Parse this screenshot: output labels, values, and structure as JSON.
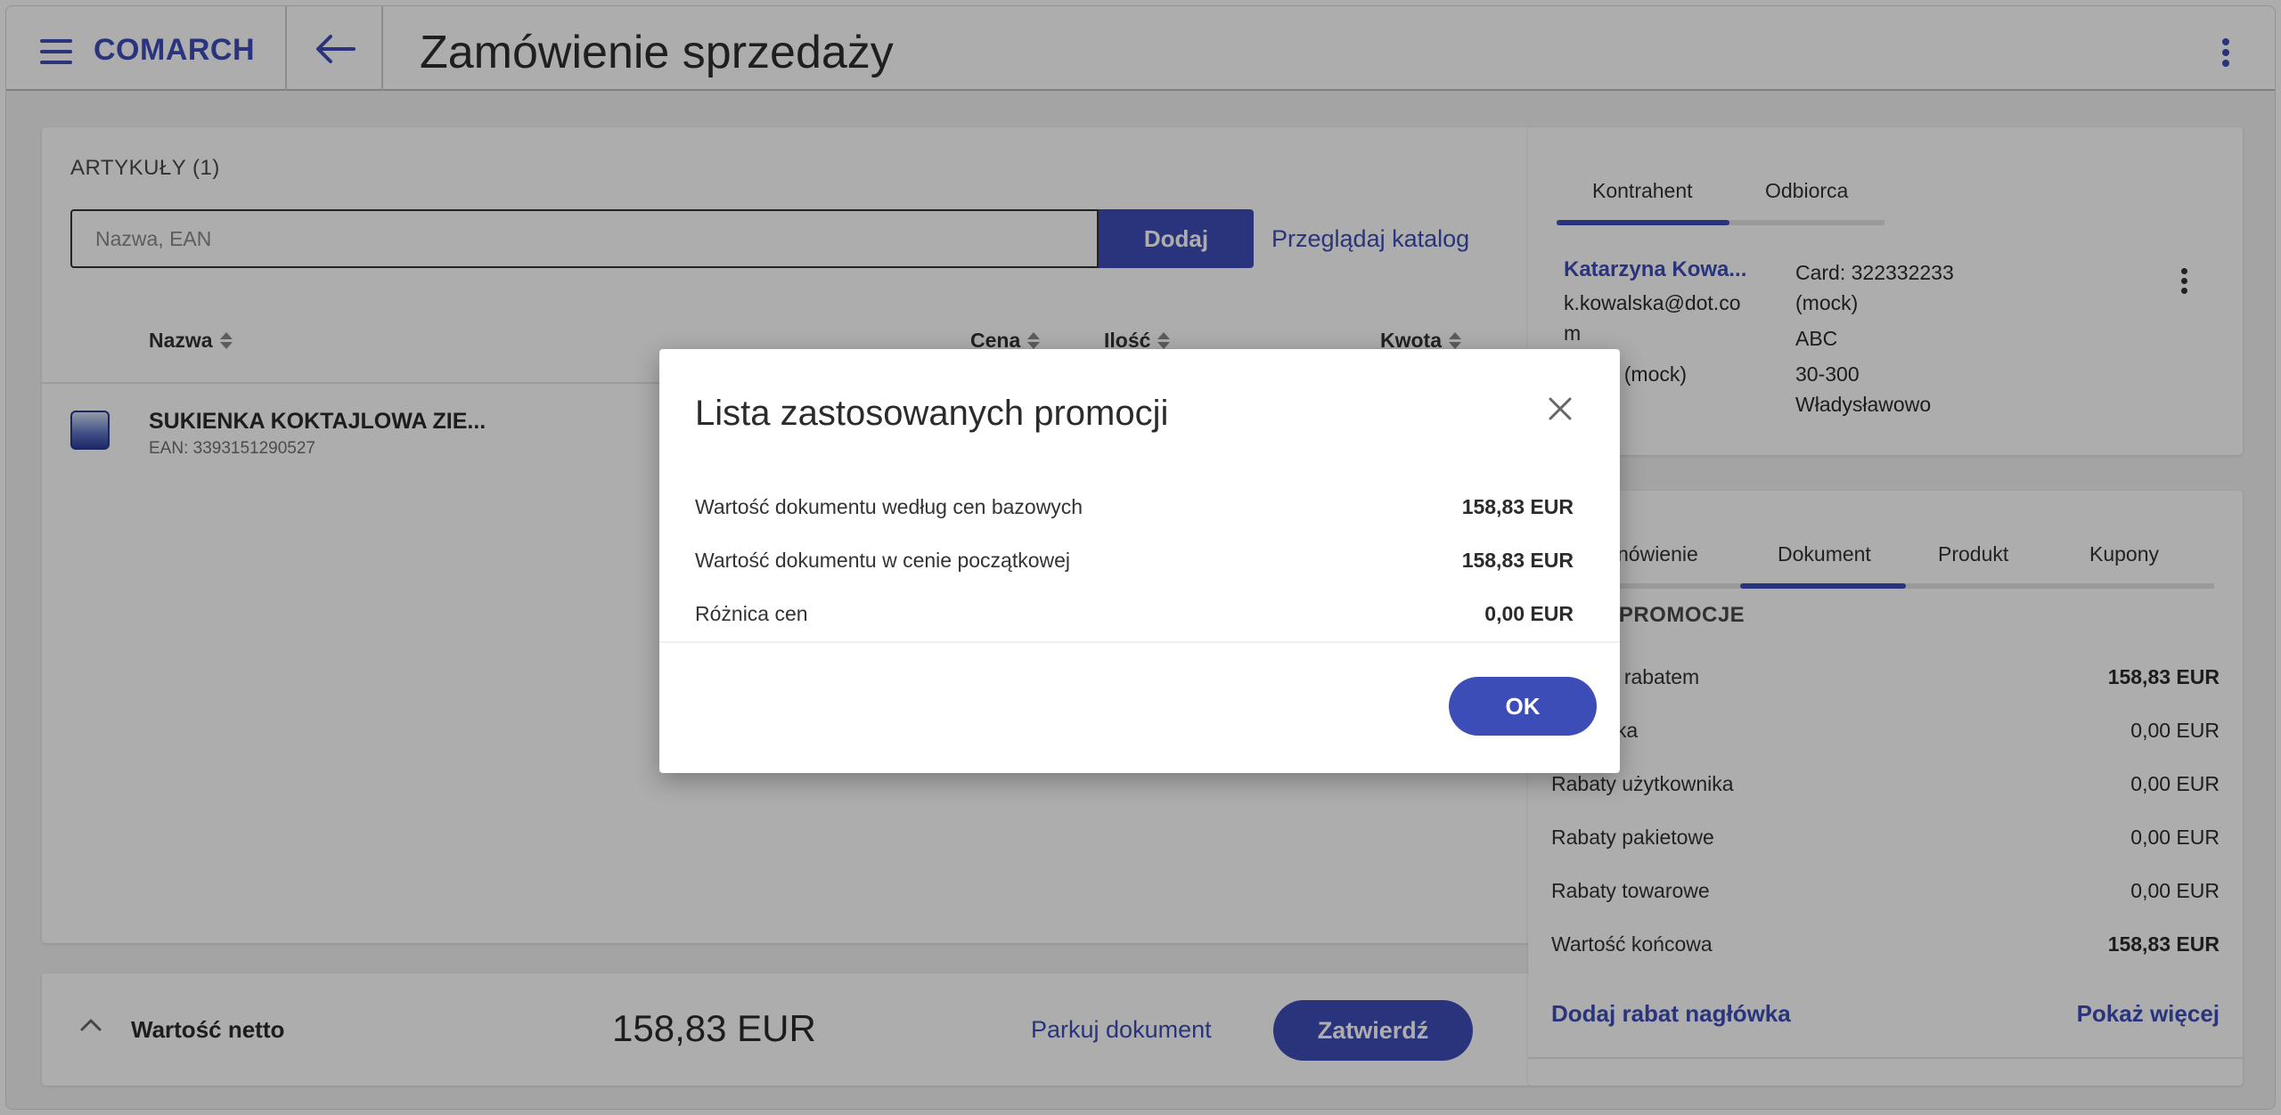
{
  "header": {
    "logo": "COMARCH",
    "title": "Zamówienie sprzedaży"
  },
  "articles": {
    "heading": "ARTYKUŁY (1)",
    "search_placeholder": "Nazwa, EAN",
    "add_label": "Dodaj",
    "catalog_link": "Przeglądaj katalog",
    "columns": {
      "name": "Nazwa",
      "price": "Cena",
      "qty": "Ilość",
      "amount": "Kwota"
    },
    "rows": [
      {
        "name": "SUKIENKA KOKTAJLOWA ZIE...",
        "ean": "EAN: 3393151290527"
      }
    ]
  },
  "footer": {
    "net_label": "Wartość netto",
    "net_value": "158,83 EUR",
    "park_label": "Parkuj dokument",
    "confirm_label": "Zatwierdź"
  },
  "client": {
    "tabs": [
      "Kontrahent",
      "Odbiorca"
    ],
    "name": "Katarzyna Kowa...",
    "email_line1": "k.kowalska@dot.co",
    "email_line2": "m",
    "points": "points (mock)",
    "card_line1": "Card: 322332233",
    "card_line2": "(mock)",
    "address_line1": "ABC",
    "address_line2": "30-300",
    "address_line3": "Władysławowo"
  },
  "promotions": {
    "tabs": [
      "nówienie",
      "Dokument",
      "Produkt",
      "Kupony"
    ],
    "heading": "ZONE PROMOCJE",
    "rows": [
      {
        "label": "ć przed rabatem",
        "value": "158,83 EUR",
        "bold": true
      },
      {
        "label": "nagłówka",
        "value": "0,00 EUR",
        "bold": false
      },
      {
        "label": "Rabaty użytkownika",
        "value": "0,00 EUR",
        "bold": false
      },
      {
        "label": "Rabaty pakietowe",
        "value": "0,00 EUR",
        "bold": false
      },
      {
        "label": "Rabaty towarowe",
        "value": "0,00 EUR",
        "bold": false
      },
      {
        "label": "Wartość końcowa",
        "value": "158,83 EUR",
        "bold": true
      }
    ],
    "add_header_discount": "Dodaj rabat nagłówka",
    "show_more": "Pokaż więcej"
  },
  "modal": {
    "title": "Lista zastosowanych promocji",
    "rows": [
      {
        "label": "Wartość dokumentu według cen bazowych",
        "value": "158,83 EUR"
      },
      {
        "label": "Wartość dokumentu w cenie początkowej",
        "value": "158,83 EUR"
      },
      {
        "label": "Różnica cen",
        "value": "0,00 EUR"
      }
    ],
    "ok_label": "OK"
  },
  "colors": {
    "accent": "#3d4db7",
    "modal_button": "#4a5ae0"
  }
}
